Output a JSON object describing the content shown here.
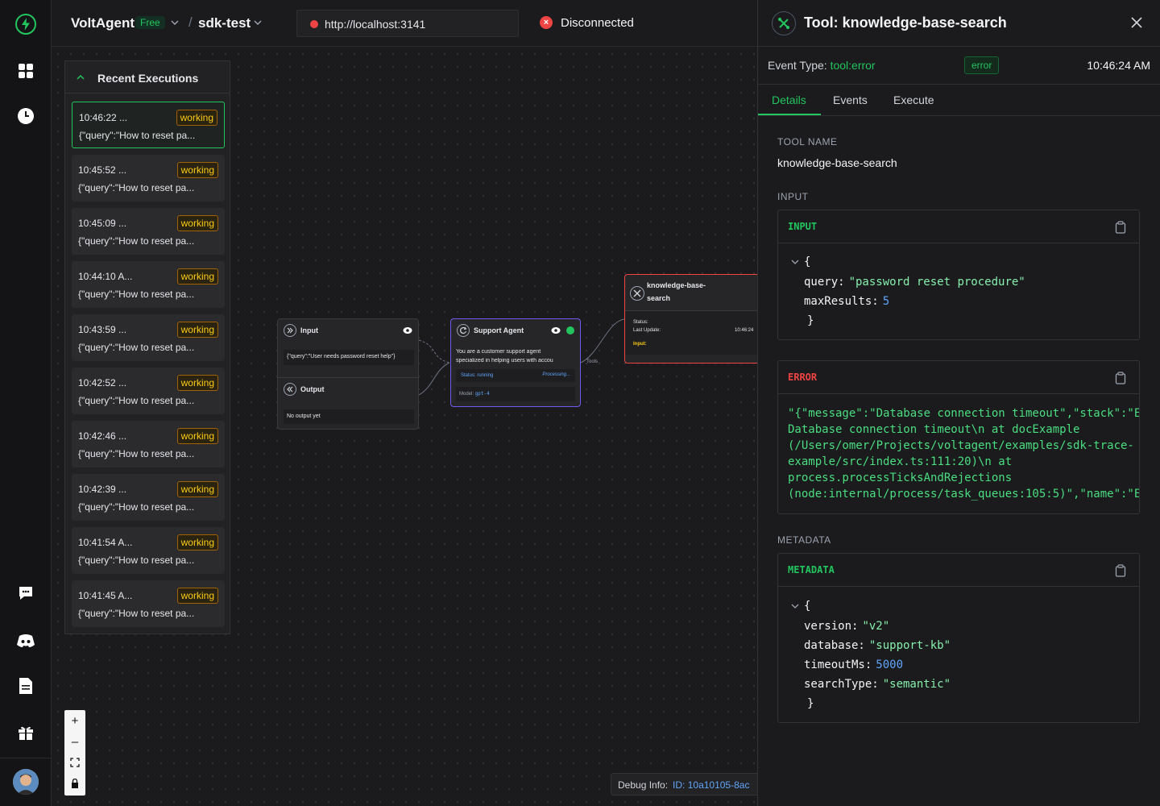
{
  "app": {
    "brand": "VoltAgent",
    "plan": "Free",
    "project": "sdk-test",
    "url": "http://localhost:3141",
    "connection": "Disconnected"
  },
  "rail": {
    "icons": [
      "voltagent-logo-icon",
      "dashboard-grid-icon",
      "history-clock-icon",
      "chat-icon",
      "discord-icon",
      "docs-icon",
      "gift-icon"
    ]
  },
  "recent": {
    "title": "Recent Executions",
    "items": [
      {
        "time": "10:46:22 ...",
        "status": "working",
        "query": "{\"query\":\"How to reset pa..."
      },
      {
        "time": "10:45:52 ...",
        "status": "working",
        "query": "{\"query\":\"How to reset pa..."
      },
      {
        "time": "10:45:09 ...",
        "status": "working",
        "query": "{\"query\":\"How to reset pa..."
      },
      {
        "time": "10:44:10 A...",
        "status": "working",
        "query": "{\"query\":\"How to reset pa..."
      },
      {
        "time": "10:43:59 ...",
        "status": "working",
        "query": "{\"query\":\"How to reset pa..."
      },
      {
        "time": "10:42:52 ...",
        "status": "working",
        "query": "{\"query\":\"How to reset pa..."
      },
      {
        "time": "10:42:46 ...",
        "status": "working",
        "query": "{\"query\":\"How to reset pa..."
      },
      {
        "time": "10:42:39 ...",
        "status": "working",
        "query": "{\"query\":\"How to reset pa..."
      },
      {
        "time": "10:41:54 A...",
        "status": "working",
        "query": "{\"query\":\"How to reset pa..."
      },
      {
        "time": "10:41:45 A...",
        "status": "working",
        "query": "{\"query\":\"How to reset pa..."
      }
    ]
  },
  "flow": {
    "input_node": {
      "title": "Input",
      "value": "{\"query\":\"User needs password reset help\"}",
      "output_title": "Output",
      "output_value": "No output yet"
    },
    "agent_node": {
      "title": "Support Agent",
      "description_1": "You are a customer support agent",
      "description_2": "specialized in helping users with accou",
      "status": "Status: running",
      "processing": "Processing...",
      "model_label": "Model:",
      "model": "gpt-4",
      "tools_label": "Tools"
    },
    "tool_node": {
      "title_1": "knowledge-base-",
      "title_2": "search",
      "status_label": "Status:",
      "update_label": "Last Update:",
      "update_value": "10:46:24",
      "input_label": "Input:"
    }
  },
  "debug": {
    "label": "Debug Info:",
    "value": "ID: 10a10105-8ac"
  },
  "panel": {
    "title": "Tool: knowledge-base-search",
    "event_type_label": "Event Type:",
    "event_type": "tool:error",
    "event_badge": "error",
    "event_time": "10:46:24 AM",
    "tabs": [
      "Details",
      "Events",
      "Execute"
    ],
    "tool_name_label": "TOOL NAME",
    "tool_name": "knowledge-base-search",
    "input_section": "INPUT",
    "input_card": {
      "title": "INPUT",
      "open": "{",
      "close": "}",
      "fields": [
        {
          "key": "query:",
          "value": "\"password reset procedure\""
        },
        {
          "key": "maxResults:",
          "value": "5"
        }
      ]
    },
    "error_card": {
      "title": "ERROR",
      "lines": [
        "\"{\"message\":\"Database connection timeout\",\"stack\":\"E",
        "Database connection timeout\\n at docExample",
        "(/Users/omer/Projects/voltagent/examples/sdk-trace-",
        "example/src/index.ts:111:20)\\n at",
        "process.processTicksAndRejections",
        "(node:internal/process/task_queues:105:5)\",\"name\":\"E"
      ]
    },
    "metadata_section": "METADATA",
    "metadata_card": {
      "title": "METADATA",
      "open": "{",
      "close": "}",
      "fields": [
        {
          "key": "version:",
          "value": "\"v2\""
        },
        {
          "key": "database:",
          "value": "\"support-kb\""
        },
        {
          "key": "timeoutMs:",
          "value": "5000"
        },
        {
          "key": "searchType:",
          "value": "\"semantic\""
        }
      ]
    }
  },
  "colors": {
    "accent": "#22c55e",
    "error": "#ef4444",
    "warning": "#facc15",
    "link": "#60a5fa"
  }
}
